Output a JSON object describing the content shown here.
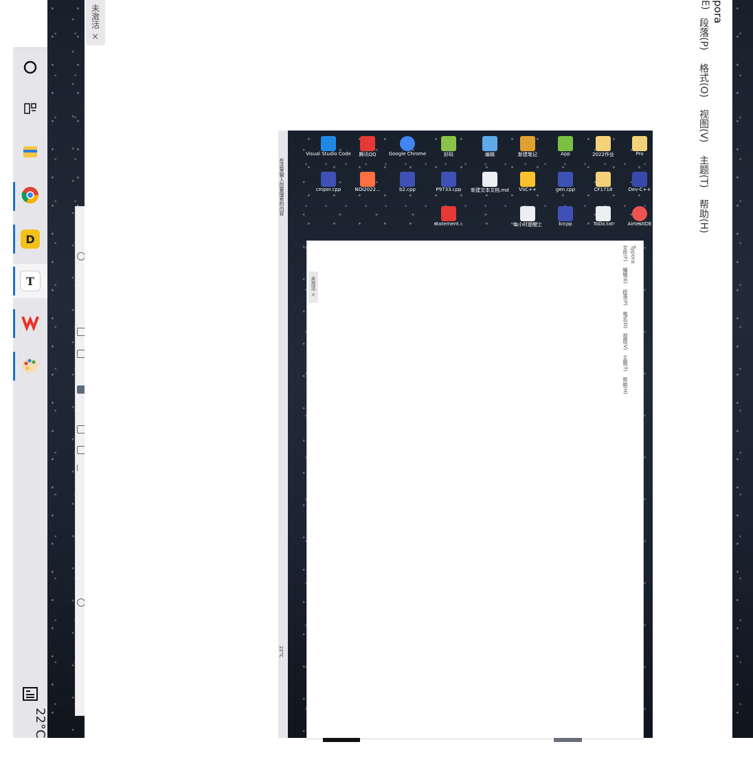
{
  "taskbar": {
    "apps": [
      {
        "name": "search",
        "icon": "circle"
      },
      {
        "name": "task-view",
        "icon": "task-view"
      },
      {
        "name": "file-explorer",
        "icon": "folder"
      },
      {
        "name": "chrome",
        "icon": "chrome"
      },
      {
        "name": "app-d",
        "label": "D",
        "color": "#f2c21b"
      },
      {
        "name": "typora",
        "label": "T"
      },
      {
        "name": "wps",
        "icon": "wps",
        "color": "#e8322a"
      },
      {
        "name": "paint",
        "icon": "palette"
      }
    ],
    "weather": "22°C"
  },
  "window": {
    "title_fragment": "pora",
    "menu": [
      "E)",
      "段落(P)",
      "格式(O)",
      "视图(V)",
      "主题(T)",
      "帮助(H)"
    ],
    "tab_label": "未激活 ×"
  },
  "nested": {
    "title": "Typora",
    "menu": [
      "文件(F)",
      "编辑(E)",
      "段落(P)",
      "格式(O)",
      "视图(V)",
      "主题(T)",
      "帮助(H)"
    ],
    "tab_label": "未激活 ×",
    "desktop_items": [
      {
        "label": "Pro",
        "color": "#f3d27a"
      },
      {
        "label": "2022作业",
        "color": "#f3d27a"
      },
      {
        "label": "App",
        "color": "#7bc043"
      },
      {
        "label": "新建笔记",
        "color": "#e0a030"
      },
      {
        "label": "编辑",
        "color": "#5da9e9"
      },
      {
        "label": "好码",
        "color": "#8bc34a"
      },
      {
        "label": "Google Chrome",
        "color": "#4285f4"
      },
      {
        "label": "腾讯QQ",
        "color": "#e53935"
      },
      {
        "label": "Visual Studio Code",
        "color": "#1e88e5"
      },
      {
        "label": "Dev-C++",
        "color": "#3949ab"
      },
      {
        "label": "CF1718",
        "color": "#f3d27a"
      },
      {
        "label": "gen.cpp",
        "color": "#3f51b5"
      },
      {
        "label": "VSC++",
        "color": "#fbc02d"
      },
      {
        "label": "新建文本文档.md",
        "color": "#eceff1"
      },
      {
        "label": "P9733.cpp",
        "color": "#3f51b5"
      },
      {
        "label": "b2.cpp",
        "color": "#3f51b5"
      },
      {
        "label": "NOI2022...",
        "color": "#ff7043"
      },
      {
        "label": "cmper.cpp",
        "color": "#3f51b5"
      },
      {
        "label": "AirtestIDE",
        "color": "#ef5350"
      },
      {
        "label": "ToDo.txt",
        "color": "#eceff1"
      },
      {
        "label": "b.cpp",
        "color": "#3f51b5"
      },
      {
        "label": "每小时提醒上",
        "color": "#eceff1"
      },
      {
        "label": "statement...",
        "color": "#e53935"
      }
    ],
    "status": "在这里输入你要搜索的内容",
    "weather": "22°C"
  }
}
